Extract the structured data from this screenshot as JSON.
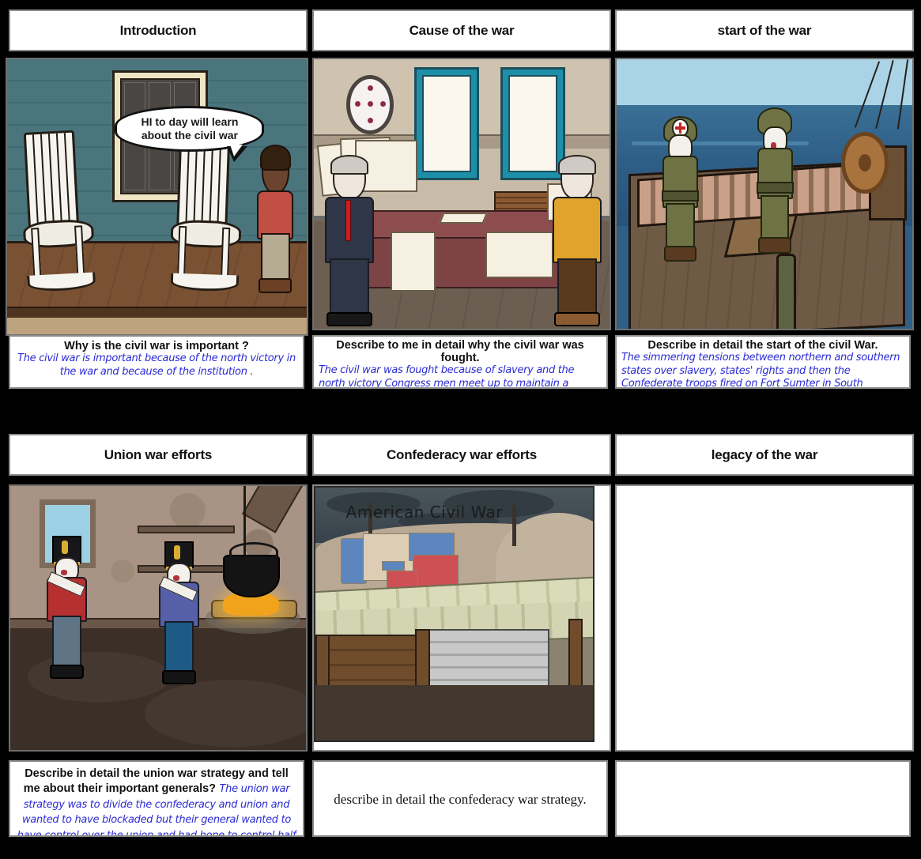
{
  "storyboard": {
    "background_color": "#000000",
    "panel_border_color": "#8c8c8c",
    "handwriting_color": "#2b2bd6"
  },
  "cells": [
    {
      "id": "introduction",
      "title": "Introduction",
      "scene": {
        "name": "porch-scene",
        "speech_bubble": "HI to day will learn about the civil war"
      },
      "caption": {
        "question": "Why is the civil war is important ?",
        "answer": "The civil war is important because of the north victory in the war and because of the institution .",
        "inline": false,
        "style": "handwriting"
      }
    },
    {
      "id": "cause-of-the-war",
      "title": "Cause of the war",
      "scene": {
        "name": "office-scene",
        "speech_bubble": ""
      },
      "caption": {
        "question": "Describe to me in detail why the civil war was fought.",
        "answer": "The civil war was fought because of slavery and the north victory Congress men meet up to maintain a balance free states an slave statescompromise of eighteen twentyMissouri.",
        "inline": false,
        "style": "handwriting"
      }
    },
    {
      "id": "start-of-the-war",
      "title": "start of the war",
      "scene": {
        "name": "ship-deck-scene",
        "speech_bubble": ""
      },
      "caption": {
        "question": "Describe in detail the start of the civil War.",
        "answer": "The simmering tensions between northern and southern states over slavery, states' rights and then the Confederate troops fired on Fort Sumter in South Carolina's Charleston Harbor.",
        "inline": false,
        "style": "handwriting"
      }
    },
    {
      "id": "union-war-efforts",
      "title": "Union war efforts",
      "scene": {
        "name": "barracks-scene",
        "speech_bubble": ""
      },
      "caption": {
        "question": "Describe in detail the union war strategy and tell me about their important generals?",
        "answer": "The union war strategy was to divide the confederacy and union and wanted to have blockaded but their general wanted to have control over the union and had hope to control half of the south and part of Mississippi",
        "inline": true,
        "style": "handwriting"
      }
    },
    {
      "id": "confederacy-war-efforts",
      "title": "Confederacy war efforts",
      "scene": {
        "name": "trench-map-scene",
        "label": "American Civil War"
      },
      "caption": {
        "question": "describe in detail the confederacy war strategy.",
        "answer": "",
        "inline": false,
        "style": "serif"
      }
    },
    {
      "id": "legacy-of-the-war",
      "title": "legacy of the war",
      "scene": {
        "name": "empty-scene",
        "speech_bubble": ""
      },
      "caption": {
        "question": "",
        "answer": "",
        "inline": false,
        "style": "blank"
      }
    }
  ]
}
